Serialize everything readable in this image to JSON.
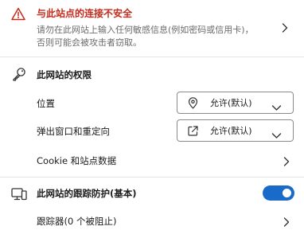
{
  "warning": {
    "title": "与此站点的连接不安全",
    "description_line1": "请勿在此网站上输入任何敏感信息(例如密码或信用卡)，",
    "description_line2": "否则可能会被攻击者窃取。",
    "icon": "warning-triangle-icon",
    "icon_color": "#c42b1c"
  },
  "permissions": {
    "title": "此网站的权限",
    "icon": "key-icon",
    "rows": [
      {
        "label": "位置",
        "value": "允许(默认)",
        "icon": "location-pin-icon"
      },
      {
        "label": "弹出窗口和重定向",
        "value": "允许(默认)",
        "icon": "external-link-icon"
      }
    ],
    "cookie_label": "Cookie 和站点数据"
  },
  "tracking": {
    "title": "此网站的跟踪防护(基本)",
    "icon": "tracking-prevention-icon",
    "toggle_on": true,
    "toggle_color": "#1a6bc9",
    "trackers_label": "跟踪器(0 个被阻止)"
  }
}
